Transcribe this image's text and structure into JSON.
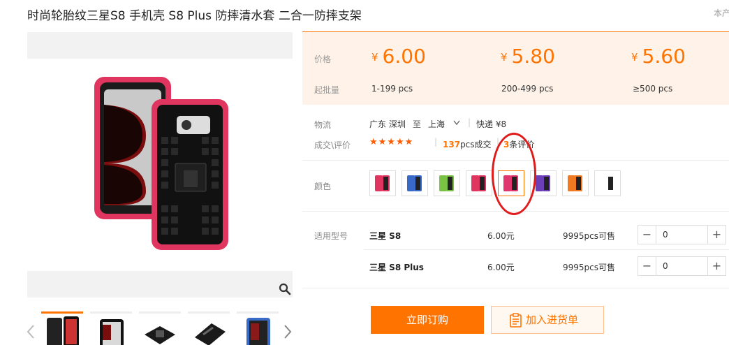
{
  "product": {
    "title": "时尚轮胎纹三星S8 手机壳 S8 Plus 防摔清水套 二合一防摔支架"
  },
  "corner_text": "本产",
  "pricing": {
    "price_label": "价格",
    "moq_label": "起批量",
    "currency": "¥",
    "tiers": [
      {
        "price": "6.00",
        "range": "1-199 pcs"
      },
      {
        "price": "5.80",
        "range": "200-499 pcs"
      },
      {
        "price": "5.60",
        "range": "≥500 pcs"
      }
    ]
  },
  "logistics": {
    "label": "物流",
    "from": "广东 深圳",
    "to_word": "至",
    "to": "上海",
    "shipping": "快递 ¥8"
  },
  "reviews": {
    "label": "成交\\评价",
    "stars": "★★★★★",
    "deals_count": "137",
    "deals_suffix": "pcs成交",
    "review_count": "3",
    "review_suffix": "条评价"
  },
  "color": {
    "label": "颜色",
    "selected_index": 4,
    "swatches": [
      {
        "accent": "#e0355f"
      },
      {
        "accent": "#3a6ac8"
      },
      {
        "accent": "#7bc143"
      },
      {
        "accent": "#e0355f"
      },
      {
        "accent": "#e0356f"
      },
      {
        "accent": "#6c3fb8"
      },
      {
        "accent": "#f07a21"
      },
      {
        "accent": "#ffffff"
      }
    ]
  },
  "models": {
    "label": "适用型号",
    "rows": [
      {
        "name": "三星 S8",
        "price": "6.00元",
        "stock_num": "9995",
        "stock_suffix": "pcs可售",
        "qty": "0"
      },
      {
        "name": "三星 S8 Plus",
        "price": "6.00元",
        "stock_num": "9995",
        "stock_suffix": "pcs可售",
        "qty": "0"
      }
    ]
  },
  "actions": {
    "buy": "立即订购",
    "add_to_cart": "加入进货单"
  },
  "colors": {
    "accent": "#ff7300",
    "band": "#fff2e8",
    "annotation": "#e01b1b"
  }
}
